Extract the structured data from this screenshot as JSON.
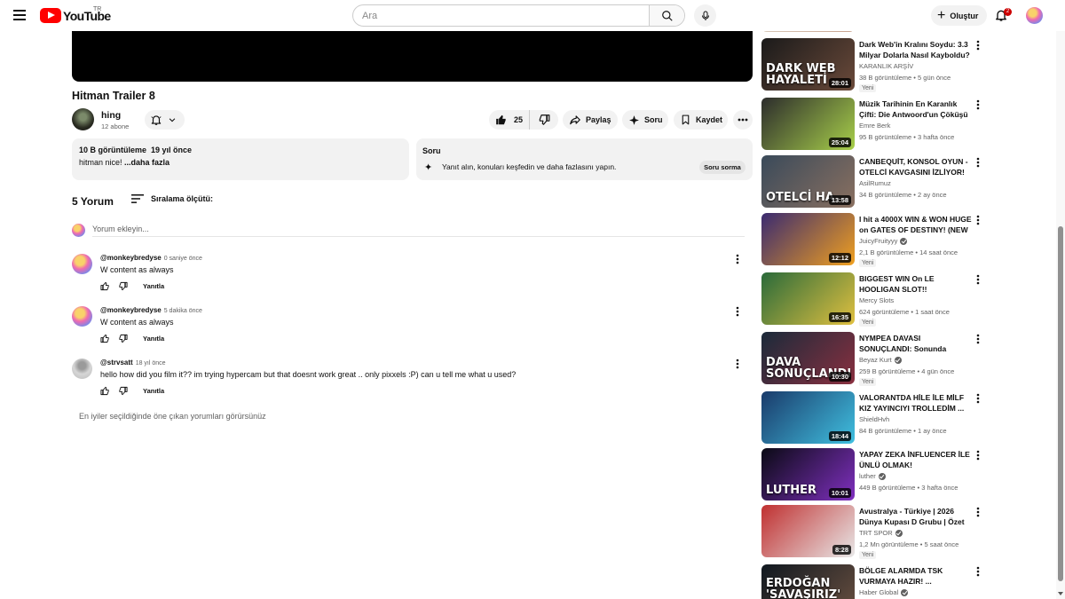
{
  "header": {
    "logo_text": "YouTube",
    "region": "TR",
    "search_placeholder": "Ara",
    "create_label": "Oluştur",
    "notification_count": "2"
  },
  "video": {
    "title": "Hitman Trailer 8",
    "channel": "hing",
    "subscribers": "12 abone",
    "likes": "25",
    "share_label": "Paylaş",
    "ask_label": "Soru",
    "save_label": "Kaydet",
    "description": {
      "views": "10 B görüntüleme",
      "date": "19 yıl önce",
      "text": "hitman nice! ",
      "more": "...daha fazla"
    },
    "ask_box": {
      "title": "Soru",
      "text": "Yanıt alın, konuları keşfedin ve daha fazlasını yapın.",
      "button": "Soru sorma"
    }
  },
  "comments": {
    "count_label": "5 Yorum",
    "sort_label": "Sıralama ölçütü:",
    "add_placeholder": "Yorum ekleyin...",
    "reply_label": "Yanıtla",
    "items": [
      {
        "author": "@monkeybredyse",
        "time": "0 saniye önce",
        "text": "W content as always"
      },
      {
        "author": "@monkeybredyse",
        "time": "5 dakika önce",
        "text": "W content as always"
      },
      {
        "author": "@strvsatt",
        "time": "18 yıl önce",
        "text": "hello how did you film it?? im trying  hypercam but that doesnt work great .. only pixxels :P) can u tell me what u used?"
      }
    ],
    "footer_note": "En iyiler seçildiğinde öne çıkan yorumları görürsünüz"
  },
  "recommendations": [
    {
      "title": "Dark Web'in Kralını Soydu: 3.3 Milyar Dolarla Nasıl Kayboldu?",
      "channel": "KARANLIK ARŞİV",
      "verified": false,
      "views": "38 B görüntüleme",
      "age": "5 gün önce",
      "badge": "Yeni",
      "duration": "28:01",
      "thumb_text": "DARK WEB\nHAYALETİ",
      "color_a": "#1a1a1a",
      "color_b": "#6b4a3a"
    },
    {
      "title": "Müzik Tarihinin En Karanlık Çifti: Die Antwoord'un Çöküşü",
      "channel": "Emre Berk",
      "verified": false,
      "views": "95 B görüntüleme",
      "age": "3 hafta önce",
      "badge": "",
      "duration": "25:04",
      "thumb_text": "",
      "color_a": "#2c2c2c",
      "color_b": "#a8d04a"
    },
    {
      "title": "CANBEQUİT, KONSOL OYUN - OTELCİ KAVGASINI İZLİYOR!",
      "channel": "AsilRumuz",
      "verified": false,
      "views": "34 B görüntüleme",
      "age": "2 ay önce",
      "badge": "",
      "duration": "13:58",
      "thumb_text": "OTELCİ HA",
      "color_a": "#3a4a5a",
      "color_b": "#8a7060"
    },
    {
      "title": "I hit a 4000X WIN & WON HUGE on GATES OF DESTINY! (NEW ...",
      "channel": "JuicyFruityyy",
      "verified": true,
      "views": "2,1 B görüntüleme",
      "age": "14 saat önce",
      "badge": "Yeni",
      "duration": "12:12",
      "thumb_text": "",
      "color_a": "#3a2a70",
      "color_b": "#f0a020"
    },
    {
      "title": "BIGGEST WIN On LE HOOLIGAN SLOT!!",
      "channel": "Mercy Slots",
      "verified": false,
      "views": "624 görüntüleme",
      "age": "1 saat önce",
      "badge": "Yeni",
      "duration": "16:35",
      "thumb_text": "",
      "color_a": "#2a6a3a",
      "color_b": "#e0c040"
    },
    {
      "title": "NYMPEA DAVASI SONUÇLANDI: Sonunda",
      "channel": "Beyaz Kurt",
      "verified": true,
      "views": "259 B görüntüleme",
      "age": "4 gün önce",
      "badge": "Yeni",
      "duration": "10:30",
      "thumb_text": "DAVA\nSONUÇLANDI",
      "color_a": "#1a2a3a",
      "color_b": "#8a3040"
    },
    {
      "title": "VALORANTDA HİLE İLE MİLF KIZ YAYINCIYI TROLLEDİM ...",
      "channel": "ShieldHvh",
      "verified": false,
      "views": "84 B görüntüleme",
      "age": "1 ay önce",
      "badge": "",
      "duration": "18:44",
      "thumb_text": "",
      "color_a": "#1a3a6a",
      "color_b": "#40c0e0"
    },
    {
      "title": "YAPAY ZEKA İNFLUENCER İLE ÜNLÜ OLMAK!",
      "channel": "luther",
      "verified": true,
      "views": "449 B görüntüleme",
      "age": "3 hafta önce",
      "badge": "",
      "duration": "10:01",
      "thumb_text": "LUTHER",
      "color_a": "#0a0a14",
      "color_b": "#8030c0"
    },
    {
      "title": "Avustralya - Türkiye | 2026 Dünya Kupası D Grubu | Özet X...",
      "channel": "TRT SPOR",
      "verified": true,
      "views": "1,2 Mn görüntüleme",
      "age": "5 saat önce",
      "badge": "Yeni",
      "duration": "8:28",
      "thumb_text": "",
      "color_a": "#c03030",
      "color_b": "#e8e8e8"
    },
    {
      "title": "BÖLGE ALARMDA TSK VURMAYA HAZIR! ...",
      "channel": "Haber Global",
      "verified": true,
      "views": "",
      "age": "",
      "badge": "",
      "duration": "",
      "thumb_text": "ERDOĞAN\n'SAVAŞIRIZ'\nDEDİ!",
      "color_a": "#101820",
      "color_b": "#6a5040"
    }
  ]
}
